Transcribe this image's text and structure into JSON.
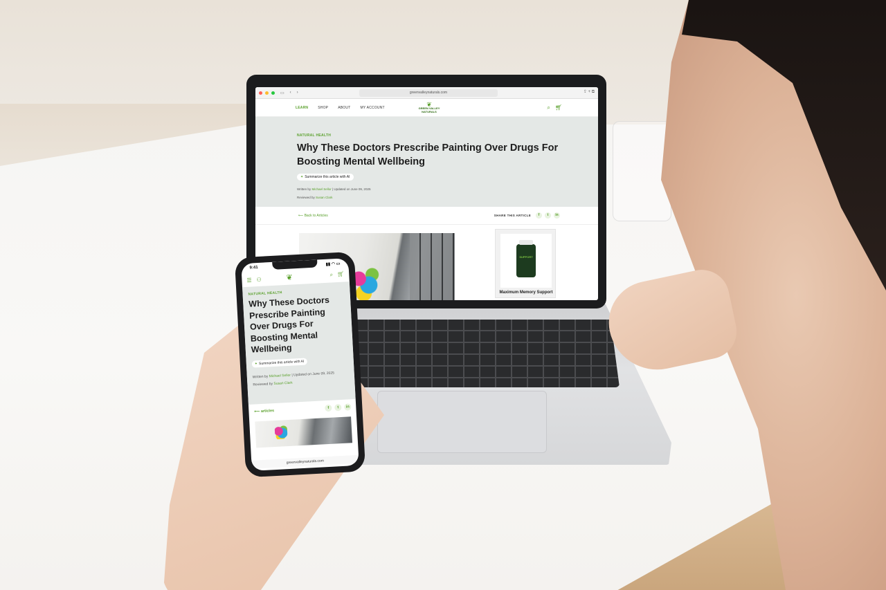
{
  "laptop": {
    "browser": {
      "url": "greenvalleynaturals.com"
    },
    "nav": {
      "links": [
        "LEARN",
        "SHOP",
        "ABOUT",
        "MY ACCOUNT"
      ],
      "logo_line1": "GREEN VALLEY",
      "logo_line2": "NATURALS"
    },
    "article": {
      "category": "NATURAL HEALTH",
      "title": "Why These Doctors Prescribe Painting Over Drugs For Boosting Mental Wellbeing",
      "ai_button": "Summarize this article with AI",
      "written_by": "Written by",
      "author": "Michael Sellor",
      "updated": "| Updated on June 09, 2025",
      "reviewed_by": "Reviewed by",
      "reviewer": "Susan Clark",
      "back_link": "Back to Articles",
      "share_label": "SHARE THIS ARTICLE"
    },
    "product": {
      "bottle_label": "SUPPORT",
      "name": "Maximum Memory Support"
    }
  },
  "phone": {
    "status_time": "9:41",
    "article": {
      "category": "NATURAL HEALTH",
      "title": "Why These Doctors Prescribe Painting Over Drugs For Boosting Mental Wellbeing",
      "ai_button": "Summarize this article with AI",
      "written_by": "Written by",
      "author": "Michael Sellor",
      "updated": "| Updated on June 09, 2025",
      "reviewed_by": "Reviewed by",
      "reviewer": "Susan Clark",
      "back_link": "articles"
    },
    "url": "greenvalleynaturals.com"
  },
  "social": {
    "facebook": "f",
    "twitter": "t",
    "linkedin": "in"
  },
  "colors": {
    "brand_green": "#5aa02c",
    "hero_bg": "#e4e8e6"
  }
}
